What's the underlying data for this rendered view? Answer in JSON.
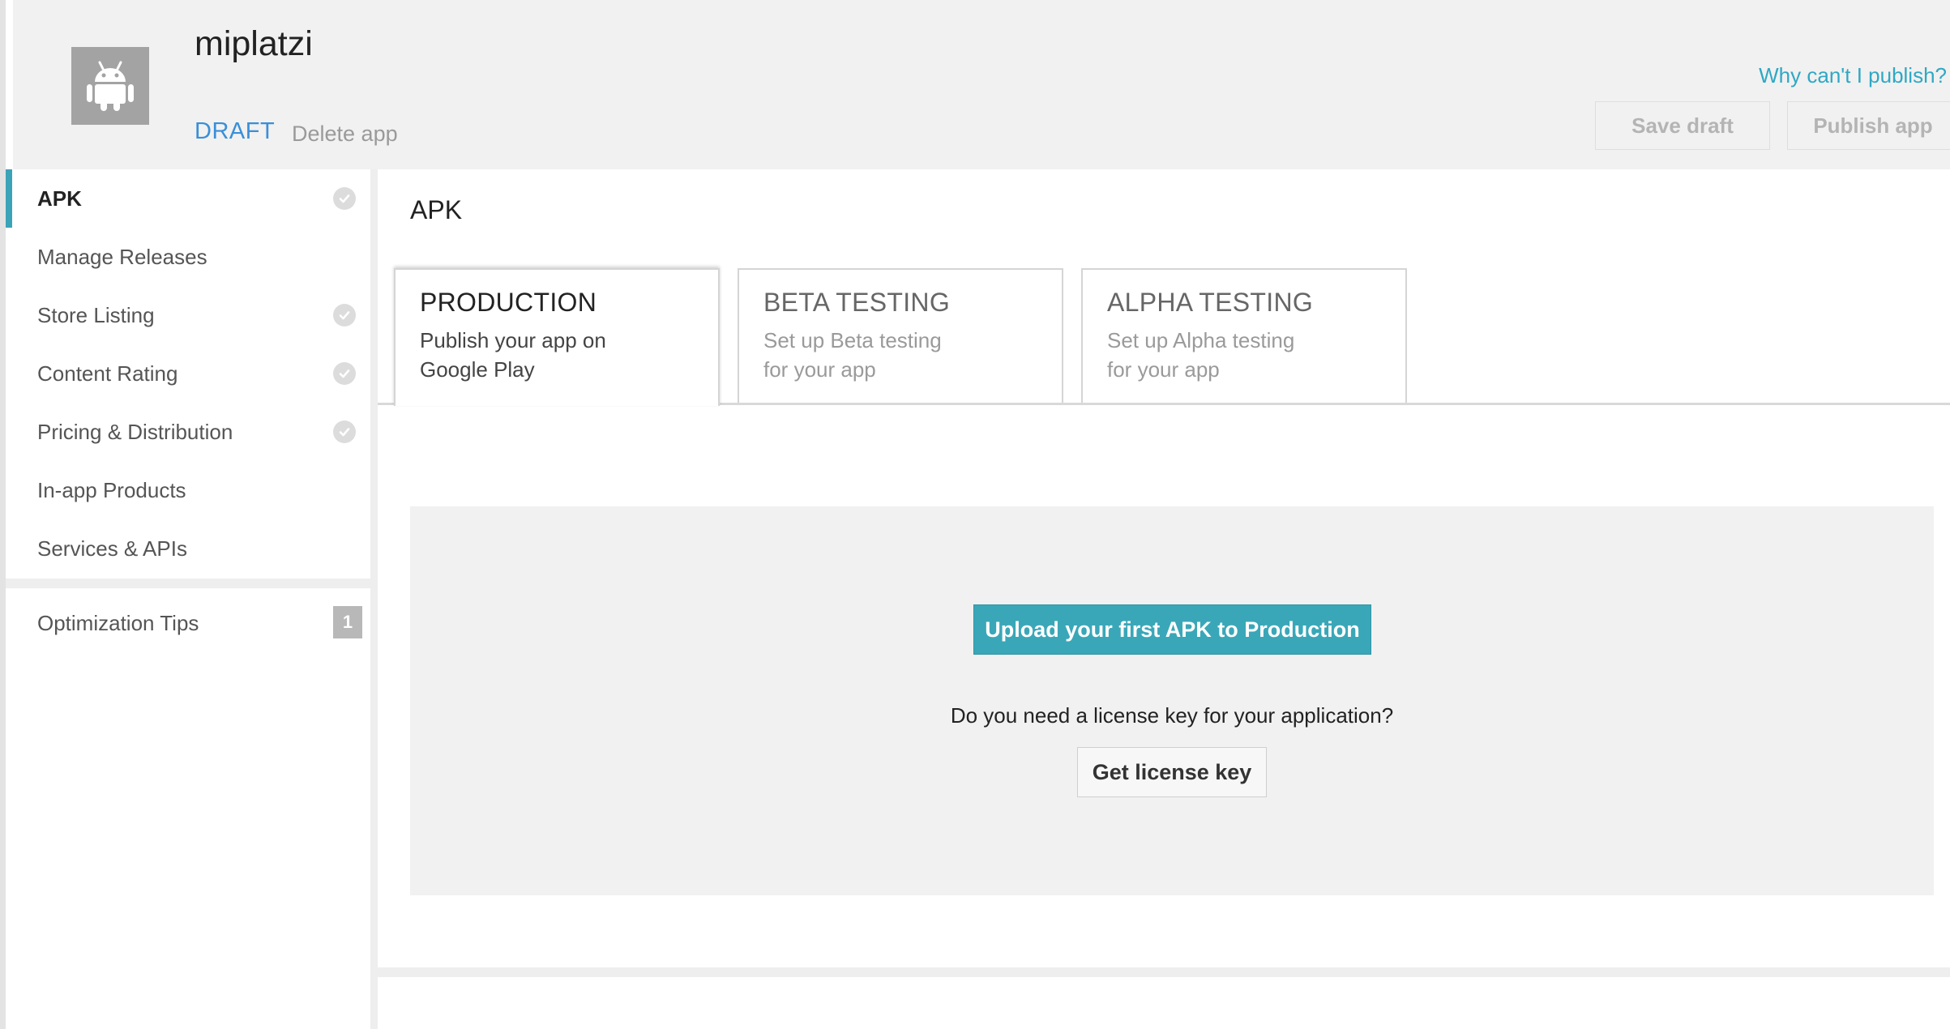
{
  "header": {
    "app_name": "miplatzi",
    "status": "DRAFT",
    "delete_label": "Delete app",
    "why_link": "Why can't I publish?",
    "save_draft": "Save draft",
    "publish_app": "Publish app"
  },
  "sidebar": {
    "items": [
      {
        "label": "APK",
        "active": true,
        "check": true
      },
      {
        "label": "Manage Releases",
        "active": false,
        "check": false
      },
      {
        "label": "Store Listing",
        "active": false,
        "check": true
      },
      {
        "label": "Content Rating",
        "active": false,
        "check": true
      },
      {
        "label": "Pricing & Distribution",
        "active": false,
        "check": true
      },
      {
        "label": "In-app Products",
        "active": false,
        "check": false
      },
      {
        "label": "Services & APIs",
        "active": false,
        "check": false
      }
    ],
    "optimization": {
      "label": "Optimization Tips",
      "badge": "1"
    }
  },
  "main": {
    "title": "APK",
    "tabs": [
      {
        "title": "PRODUCTION",
        "desc": "Publish your app on Google Play"
      },
      {
        "title": "BETA TESTING",
        "desc": "Set up Beta testing for your app"
      },
      {
        "title": "ALPHA TESTING",
        "desc": "Set up Alpha testing for your app"
      }
    ],
    "upload_button": "Upload your first APK to Production",
    "license_question": "Do you need a license key for your application?",
    "license_button": "Get license key"
  },
  "colors": {
    "accent": "#3aa7b8",
    "draft_blue": "#3a8fd8",
    "link": "#2fa8c4"
  },
  "icons": [
    "android-icon",
    "check-icon"
  ]
}
